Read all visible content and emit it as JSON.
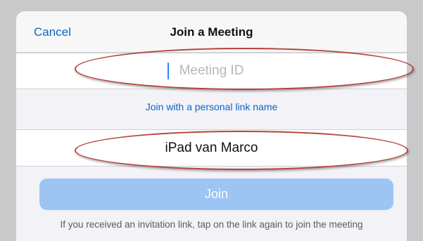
{
  "header": {
    "cancel_label": "Cancel",
    "title": "Join a Meeting"
  },
  "meeting_id": {
    "placeholder": "Meeting ID",
    "value": ""
  },
  "personal_link_label": "Join with a personal link name",
  "display_name": {
    "value": "iPad van Marco"
  },
  "join_label": "Join",
  "hint_text": "If you received an invitation link, tap on the link again to join the meeting",
  "colors": {
    "accent": "#0a66c8",
    "join_button_disabled": "#9cc5f3",
    "annotation_ellipse": "#b3443a"
  }
}
